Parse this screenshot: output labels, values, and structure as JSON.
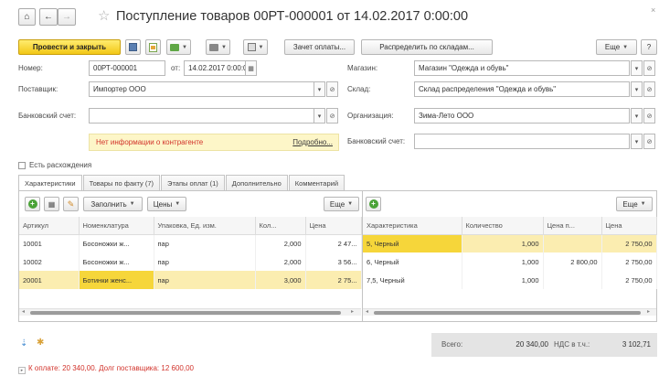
{
  "window": {
    "title": "Поступление товаров 00РТ-000001 от 14.02.2017 0:00:00",
    "nav": {
      "home": "⌂",
      "back": "←",
      "forward": "→"
    },
    "star": "☆",
    "close": "×"
  },
  "toolbar": {
    "post_close": "Провести и закрыть",
    "offset_payment": "Зачет оплаты...",
    "distribute": "Распределить по складам...",
    "more": "Еще",
    "help": "?"
  },
  "form": {
    "number_label": "Номер:",
    "number_value": "00РТ-000001",
    "date_label": "от:",
    "date_value": "14.02.2017  0:00:00",
    "supplier_label": "Поставщик:",
    "supplier_value": "Импортер ООО",
    "bank_label": "Банковский счет:",
    "bank_value": "",
    "store_label": "Магазин:",
    "store_value": "Магазин \"Одежда и обувь\"",
    "warehouse_label": "Склад:",
    "warehouse_value": "Склад распределения \"Одежда и обувь\"",
    "org_label": "Организация:",
    "org_value": "Зима-Лето ООО",
    "org_bank_label": "Банковский счет:",
    "org_bank_value": "",
    "warning": "Нет информации о контрагенте",
    "warning_link": "Подробно...",
    "discrepancy_label": "Есть расхождения"
  },
  "tabs": [
    {
      "label": "Характеристики"
    },
    {
      "label": "Товары по факту (7)"
    },
    {
      "label": "Этапы оплат (1)"
    },
    {
      "label": "Дополнительно"
    },
    {
      "label": "Комментарий"
    }
  ],
  "left_table": {
    "fill_button": "Заполнить",
    "prices_button": "Цены",
    "more_button": "Еще",
    "columns": [
      "Артикул",
      "Номенклатура",
      "Упаковка, Ед. изм.",
      "Кол...",
      "Цена"
    ],
    "rows": [
      [
        "10001",
        "Босоножки ж...",
        "пар",
        "2,000",
        "2 47..."
      ],
      [
        "10002",
        "Босоножки ж...",
        "пар",
        "2,000",
        "3 56..."
      ],
      [
        "20001",
        "Ботинки женс...",
        "пар",
        "3,000",
        "2 75..."
      ]
    ]
  },
  "right_table": {
    "more_button": "Еще",
    "columns": [
      "Характеристика",
      "Количество",
      "Цена п...",
      "Цена"
    ],
    "rows": [
      [
        "5, Черный",
        "1,000",
        "",
        "2 750,00"
      ],
      [
        "6, Черный",
        "1,000",
        "2 800,00",
        "2 750,00"
      ],
      [
        "7,5, Черный",
        "1,000",
        "",
        "2 750,00"
      ]
    ]
  },
  "totals": {
    "total_label": "Всего:",
    "total_value": "20 340,00",
    "vat_label": "НДС в т.ч.:",
    "vat_value": "3 102,71"
  },
  "footer": {
    "payment_text": "К оплате: 20 340,00. Долг поставщика: 12 600,00"
  },
  "colors": {
    "primary_button": "#f2c716",
    "warning_bg": "#fdf6c8",
    "warning_text": "#d2332b",
    "selected_row": "#f6d63a",
    "highlight_row": "#fbedb0"
  }
}
